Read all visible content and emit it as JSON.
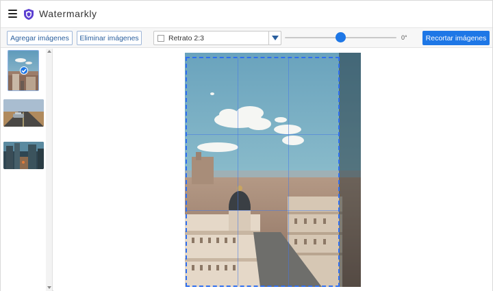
{
  "header": {
    "app_title": "Watermarkly",
    "menu_icon": "hamburger-menu-icon",
    "logo_icon": "shield-logo-icon"
  },
  "toolbar": {
    "add_images_label": "Agregar imágenes",
    "remove_images_label": "Eliminar imágenes",
    "ratio_label": "Retrato 2:3",
    "rotation_value": "0°",
    "crop_button_label": "Recortar imágenes"
  },
  "sidebar": {
    "thumbnails": [
      {
        "name": "madrid-city-thumbnail",
        "selected": true
      },
      {
        "name": "road-car-thumbnail",
        "selected": false
      },
      {
        "name": "city-street-thumbnail",
        "selected": false
      }
    ]
  },
  "colors": {
    "accent": "#1e77e6",
    "crop_border": "#2f6ff0",
    "outline_button_text": "#2a5f9e"
  }
}
